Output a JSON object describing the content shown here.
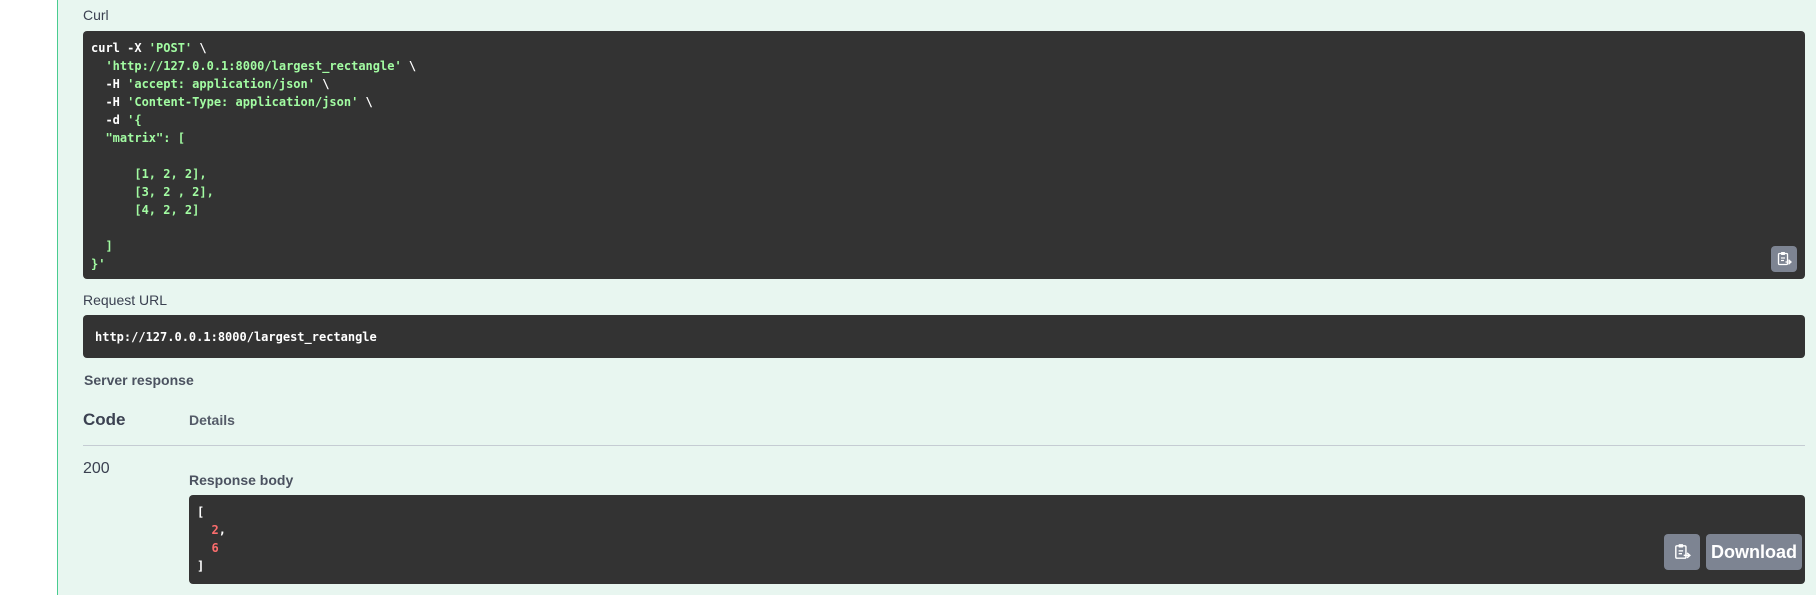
{
  "curl_section": {
    "label": "Curl",
    "lines": [
      [
        {
          "c": "w",
          "t": "curl -X "
        },
        {
          "c": "g",
          "t": "'POST'"
        },
        {
          "c": "w",
          "t": " \\"
        }
      ],
      [
        {
          "c": "w",
          "t": "  "
        },
        {
          "c": "g",
          "t": "'http://127.0.0.1:8000/largest_rectangle'"
        },
        {
          "c": "w",
          "t": " \\"
        }
      ],
      [
        {
          "c": "w",
          "t": "  -H "
        },
        {
          "c": "g",
          "t": "'accept: application/json'"
        },
        {
          "c": "w",
          "t": " \\"
        }
      ],
      [
        {
          "c": "w",
          "t": "  -H "
        },
        {
          "c": "g",
          "t": "'Content-Type: application/json'"
        },
        {
          "c": "w",
          "t": " \\"
        }
      ],
      [
        {
          "c": "w",
          "t": "  -d "
        },
        {
          "c": "g",
          "t": "'{"
        }
      ],
      [
        {
          "c": "g",
          "t": "  \"matrix\": ["
        }
      ],
      [
        {
          "c": "g",
          "t": ""
        }
      ],
      [
        {
          "c": "g",
          "t": "      [1, 2, 2],"
        }
      ],
      [
        {
          "c": "g",
          "t": "      [3, 2 , 2],"
        }
      ],
      [
        {
          "c": "g",
          "t": "      [4, 2, 2]"
        }
      ],
      [
        {
          "c": "g",
          "t": ""
        }
      ],
      [
        {
          "c": "g",
          "t": "  ]"
        }
      ],
      [
        {
          "c": "g",
          "t": "}'"
        }
      ]
    ]
  },
  "request_url": {
    "label": "Request URL",
    "value": "http://127.0.0.1:8000/largest_rectangle"
  },
  "server_response": {
    "label": "Server response",
    "code_header": "Code",
    "details_header": "Details",
    "code": "200",
    "body_label": "Response body",
    "body_lines": [
      [
        {
          "c": "w",
          "t": "["
        }
      ],
      [
        {
          "c": "w",
          "t": "  "
        },
        {
          "c": "r",
          "t": "2"
        },
        {
          "c": "w",
          "t": ","
        }
      ],
      [
        {
          "c": "w",
          "t": "  "
        },
        {
          "c": "r",
          "t": "6"
        }
      ],
      [
        {
          "c": "w",
          "t": "]"
        }
      ]
    ],
    "download_label": "Download"
  },
  "icons": {
    "copy": "clipboard-copy-icon"
  },
  "colors": {
    "panel_bg": "#e8f6f0",
    "panel_border": "#49cc90",
    "code_bg": "#333333",
    "string_green": "#a2fca2",
    "number_red": "#fc6d6d",
    "button_gray": "#7d8492"
  }
}
